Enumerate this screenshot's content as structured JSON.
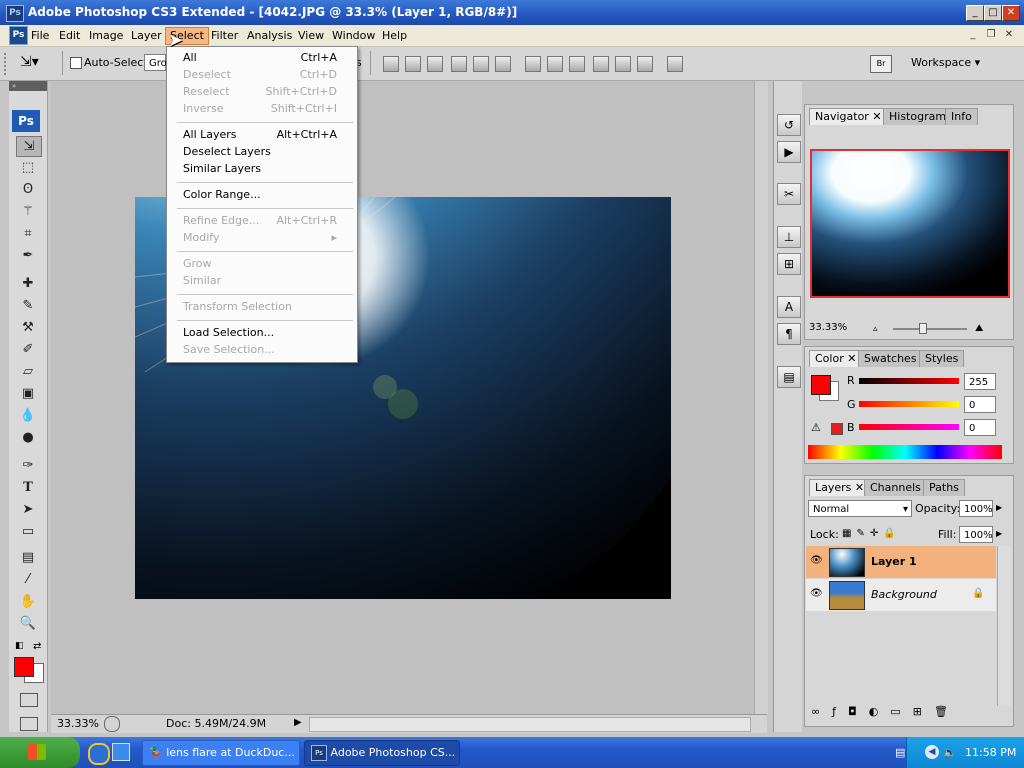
{
  "window": {
    "title": "Adobe Photoshop CS3 Extended - [4042.JPG @ 33.3% (Layer 1, RGB/8#)]",
    "app_icon": "Ps"
  },
  "menubar": {
    "items": [
      "File",
      "Edit",
      "Image",
      "Layer",
      "Select",
      "Filter",
      "Analysis",
      "View",
      "Window",
      "Help"
    ],
    "active": "Select"
  },
  "options": {
    "auto_select_label": "Auto-Select:",
    "auto_select_value": "Gro",
    "show_transform_fragment": "s",
    "workspace_label": "Workspace"
  },
  "tools": {
    "ps_logo": "Ps"
  },
  "select_menu": {
    "groups": [
      [
        {
          "label": "All",
          "shortcut": "Ctrl+A",
          "enabled": true
        },
        {
          "label": "Deselect",
          "shortcut": "Ctrl+D",
          "enabled": false
        },
        {
          "label": "Reselect",
          "shortcut": "Shift+Ctrl+D",
          "enabled": false
        },
        {
          "label": "Inverse",
          "shortcut": "Shift+Ctrl+I",
          "enabled": false
        }
      ],
      [
        {
          "label": "All Layers",
          "shortcut": "Alt+Ctrl+A",
          "enabled": true
        },
        {
          "label": "Deselect Layers",
          "shortcut": "",
          "enabled": true
        },
        {
          "label": "Similar Layers",
          "shortcut": "",
          "enabled": true
        }
      ],
      [
        {
          "label": "Color Range...",
          "shortcut": "",
          "enabled": true
        }
      ],
      [
        {
          "label": "Refine Edge...",
          "shortcut": "Alt+Ctrl+R",
          "enabled": false
        },
        {
          "label": "Modify",
          "shortcut": "▸",
          "enabled": false
        }
      ],
      [
        {
          "label": "Grow",
          "shortcut": "",
          "enabled": false
        },
        {
          "label": "Similar",
          "shortcut": "",
          "enabled": false
        }
      ],
      [
        {
          "label": "Transform Selection",
          "shortcut": "",
          "enabled": false
        }
      ],
      [
        {
          "label": "Load Selection...",
          "shortcut": "",
          "enabled": true
        },
        {
          "label": "Save Selection...",
          "shortcut": "",
          "enabled": false
        }
      ]
    ]
  },
  "status": {
    "zoom": "33.33%",
    "doc": "Doc: 5.49M/24.9M"
  },
  "navigator": {
    "tabs": [
      "Navigator",
      "Histogram",
      "Info"
    ],
    "zoom": "33.33%"
  },
  "color": {
    "tabs": [
      "Color",
      "Swatches",
      "Styles"
    ],
    "r_label": "R",
    "g_label": "G",
    "b_label": "B",
    "r": "255",
    "g": "0",
    "b": "0",
    "fg_color": "#ff0000",
    "bg_color": "#ffffff"
  },
  "layers": {
    "tabs": [
      "Layers",
      "Channels",
      "Paths"
    ],
    "blend_mode": "Normal",
    "opacity_label": "Opacity:",
    "opacity": "100%",
    "lock_label": "Lock:",
    "fill_label": "Fill:",
    "fill": "100%",
    "items": [
      {
        "name": "Layer 1",
        "selected": true
      },
      {
        "name": "Background",
        "selected": false
      }
    ]
  },
  "taskbar": {
    "task1": "lens flare at DuckDuc...",
    "task2": "Adobe Photoshop CS...",
    "clock": "11:58 PM"
  }
}
